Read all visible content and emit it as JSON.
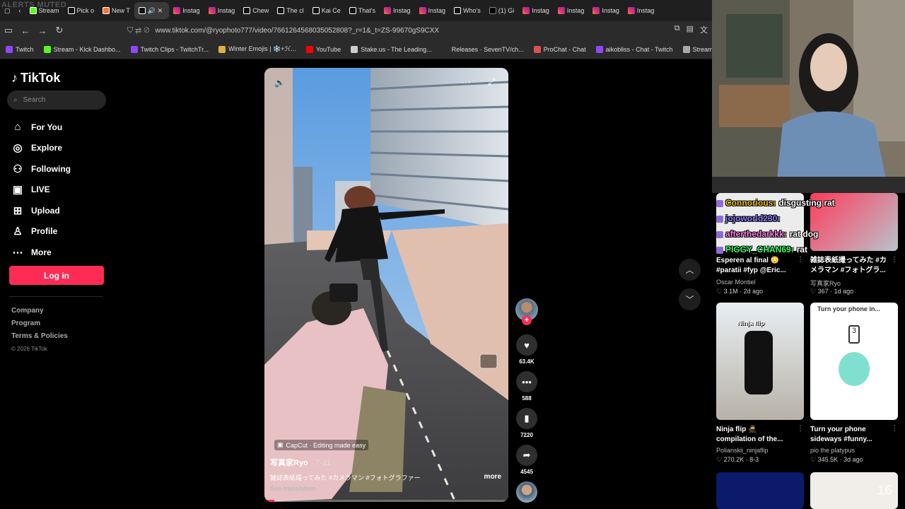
{
  "overlay": {
    "alerts_text": "ALERTS MUTED"
  },
  "browser": {
    "tabs": [
      {
        "label": "Stream",
        "icon": "kick"
      },
      {
        "label": "Pick o",
        "icon": "tiktok"
      },
      {
        "label": "New T",
        "icon": "firefox"
      },
      {
        "label": "",
        "icon": "tiktok",
        "active": true
      },
      {
        "label": "Instag",
        "icon": "instagram"
      },
      {
        "label": "Instag",
        "icon": "instagram"
      },
      {
        "label": "Chew",
        "icon": "tiktok"
      },
      {
        "label": "The cl",
        "icon": "tiktok"
      },
      {
        "label": "Kai Ce",
        "icon": "tiktok"
      },
      {
        "label": "That's",
        "icon": "tiktok"
      },
      {
        "label": "Instag",
        "icon": "instagram"
      },
      {
        "label": "Instag",
        "icon": "instagram"
      },
      {
        "label": "Who's",
        "icon": "tiktok"
      },
      {
        "label": "(1) Gi",
        "icon": "x"
      },
      {
        "label": "Instag",
        "icon": "instagram"
      },
      {
        "label": "Instag",
        "icon": "instagram"
      },
      {
        "label": "Instag",
        "icon": "instagram"
      },
      {
        "label": "Instag",
        "icon": "instagram"
      }
    ],
    "url": "www.tiktok.com/@ryophoto777/video/7661264568035052808?_r=1&_t=ZS-99670gS9CXX",
    "bookmarks": [
      {
        "label": "Twitch",
        "color": "#9146ff"
      },
      {
        "label": "Stream - Kick Dashbo...",
        "color": "#53fc18"
      },
      {
        "label": "Twitch Clips - TwitchTr...",
        "color": "#9146ff"
      },
      {
        "label": "Winter Emojis | ❄️+ℋ...",
        "color": "#e0b040"
      },
      {
        "label": "YouTube",
        "color": "#ff0000"
      },
      {
        "label": "Stake.us - The Leading...",
        "color": "#cccccc"
      },
      {
        "label": "Releases · SevenTV/ch...",
        "color": "#2b2b2b"
      },
      {
        "label": "ProChat - Chat",
        "color": "#e05050"
      },
      {
        "label": "aikobliss - Chat - Twitch",
        "color": "#9146ff"
      },
      {
        "label": "StreamElements - Das...",
        "color": "#aaaaaa"
      }
    ]
  },
  "sidebar": {
    "logo": "TikTok",
    "search_placeholder": "Search",
    "nav": [
      {
        "label": "For You",
        "icon": "home-icon"
      },
      {
        "label": "Explore",
        "icon": "compass-icon"
      },
      {
        "label": "Following",
        "icon": "following-icon"
      },
      {
        "label": "LIVE",
        "icon": "live-icon"
      },
      {
        "label": "Upload",
        "icon": "upload-icon"
      },
      {
        "label": "Profile",
        "icon": "profile-icon"
      },
      {
        "label": "More",
        "icon": "more-icon"
      }
    ],
    "login": "Log in",
    "footer": [
      "Company",
      "Program",
      "Terms & Policies"
    ],
    "copyright": "© 2026 TikTok"
  },
  "video": {
    "capcut": "CapCut · Editing made easy",
    "author": "写真家Ryo",
    "date": "· 7-11",
    "caption": "雑誌表紙撮ってみた #カメラマン #フォトグラファー",
    "more": "more",
    "translate": "See translation",
    "progress": 0.04
  },
  "actions": {
    "likes": "63.4K",
    "comments": "588",
    "saves": "7220",
    "shares": "4545"
  },
  "chat": [
    {
      "user": "Connorious:",
      "user_color": "#f0c000",
      "msg": "disgusting rat"
    },
    {
      "user": "jojoworld230:",
      "user_color": "#8a7dff",
      "msg": ""
    },
    {
      "user": "afterthedarkkk:",
      "user_color": "#ff7de6",
      "msg": "rat dog"
    },
    {
      "user": "PIGGY_CHAN69:",
      "user_color": "#33ff66",
      "msg": "rat"
    }
  ],
  "grid": [
    {
      "title": "Esperen al final 😳 #paratii #fyp @Eric...",
      "author": "Oscar Montiel",
      "stats": "♡ 3.1M · 2d ago"
    },
    {
      "title": "雑誌表紙撮ってみた #カメラマン #フォトグラ...",
      "author": "写真家Ryo",
      "stats": "♡ 367 · 1d ago"
    },
    {
      "title": "Ninja flip 🥷 compilation of the...",
      "author": "Polianskii_ninjaflip",
      "stats": "♡ 270.2K · 8-3",
      "overlay": "Ninja flip"
    },
    {
      "title": "Turn your phone sideways #funny...",
      "author": "pio the platypus",
      "stats": "♡ 345.5K · 3d ago",
      "overlay": "Turn your phone in..."
    }
  ],
  "counter": "16",
  "colors": {
    "accent": "#fe2c55"
  }
}
